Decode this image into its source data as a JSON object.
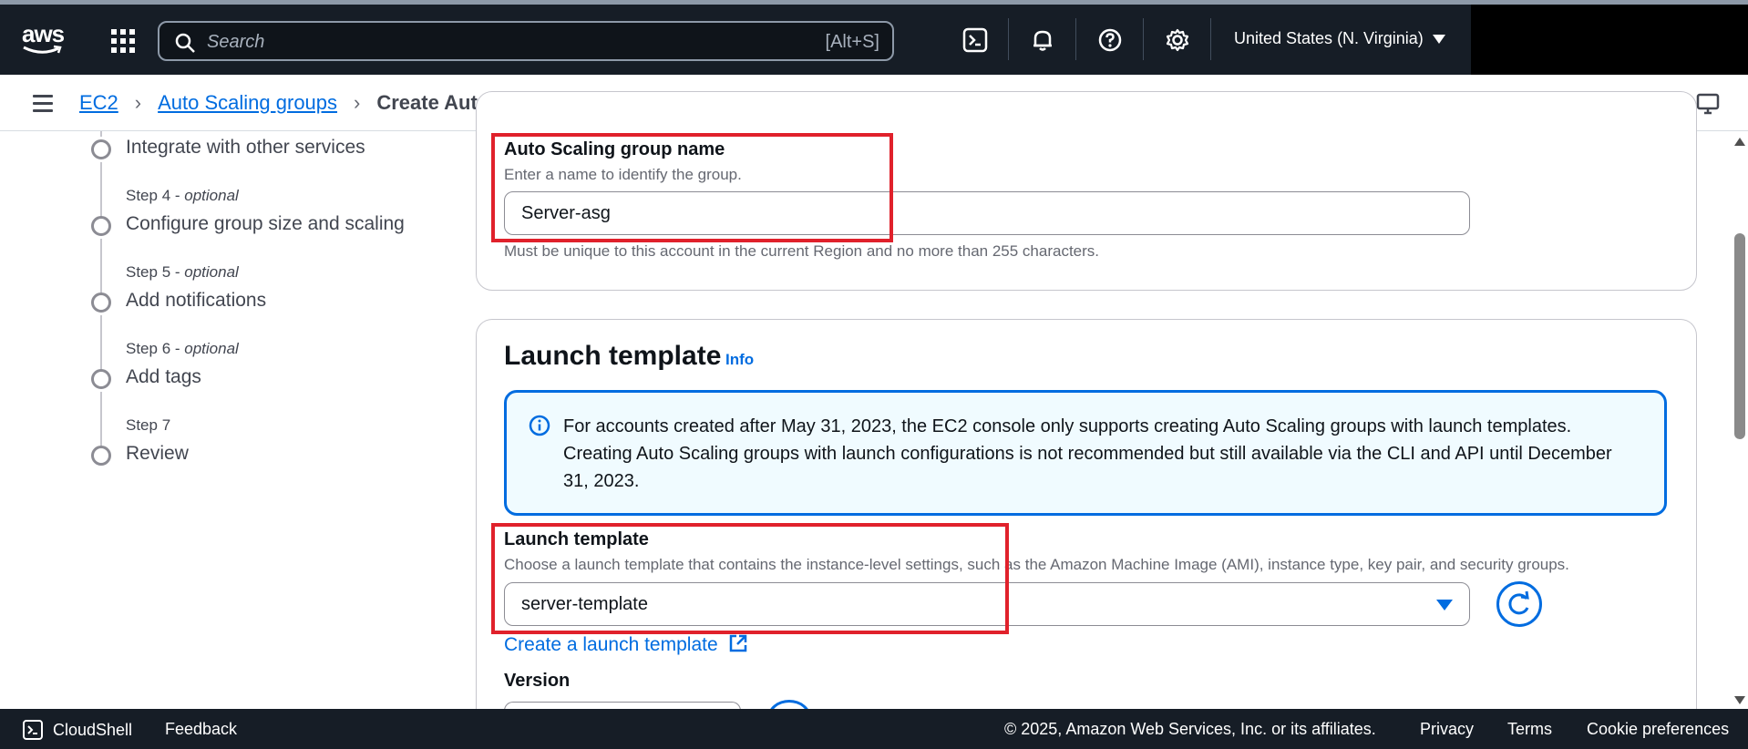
{
  "topnav": {
    "logo": "aws",
    "search_placeholder": "Search",
    "search_shortcut": "[Alt+S]",
    "region": "United States (N. Virginia)",
    "icons": [
      "cloudshell-icon",
      "bell-icon",
      "help-icon",
      "gear-icon"
    ]
  },
  "breadcrumb": {
    "items": [
      "EC2",
      "Auto Scaling groups"
    ],
    "current": "Create Auto Scaling group"
  },
  "steps": {
    "step3_title": "Integrate with other services",
    "step4_label": "Step 4 - ",
    "step4_optional": "optional",
    "step4_title": "Configure group size and scaling",
    "step5_label": "Step 5 - ",
    "step5_optional": "optional",
    "step5_title": "Add notifications",
    "step6_label": "Step 6 - ",
    "step6_optional": "optional",
    "step6_title": "Add tags",
    "step7_label": "Step 7",
    "step7_title": "Review"
  },
  "name_section": {
    "label": "Auto Scaling group name",
    "description": "Enter a name to identify the group.",
    "value": "Server-asg",
    "hint": "Must be unique to this account in the current Region and no more than 255 characters."
  },
  "launch_template_section": {
    "heading": "Launch template",
    "info": "Info",
    "alert": "For accounts created after May 31, 2023, the EC2 console only supports creating Auto Scaling groups with launch templates. Creating Auto Scaling groups with launch configurations is not recommended but still available via the CLI and API until December 31, 2023.",
    "field_label": "Launch template",
    "field_description": "Choose a launch template that contains the instance-level settings, such as the Amazon Machine Image (AMI), instance type, key pair, and security groups.",
    "selected": "server-template",
    "create_link": "Create a launch template",
    "version_label": "Version"
  },
  "footer": {
    "cloudshell": "CloudShell",
    "feedback": "Feedback",
    "copyright": "© 2025, Amazon Web Services, Inc. or its affiliates.",
    "privacy": "Privacy",
    "terms": "Terms",
    "cookie": "Cookie preferences"
  },
  "colors": {
    "nav_bg": "#161d26",
    "link_blue": "#006ce0",
    "highlight_red": "#e0212b",
    "alert_bg": "#f0fbff"
  }
}
